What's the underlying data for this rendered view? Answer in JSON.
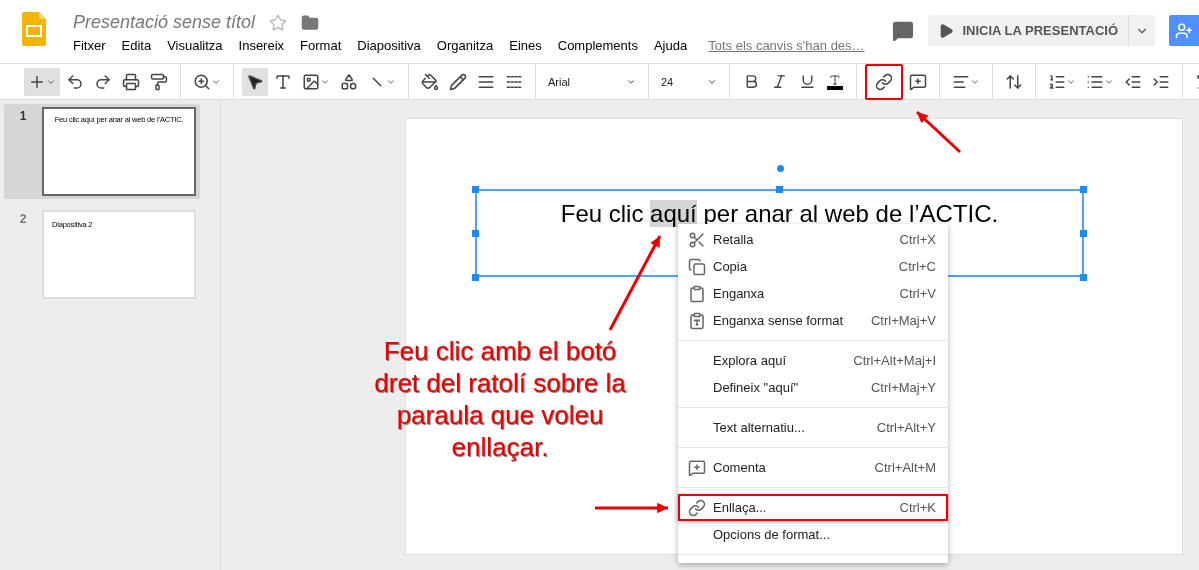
{
  "document": {
    "title": "Presentació sense títol",
    "starred": false
  },
  "menu_bar": [
    "Fitxer",
    "Edita",
    "Visualitza",
    "Insereix",
    "Format",
    "Diapositiva",
    "Organitza",
    "Eines",
    "Complements",
    "Ajuda"
  ],
  "save_status": "Tots els canvis s'han des…",
  "present_button": "INICIA LA PRESENTACIÓ",
  "toolbar": {
    "font": "Arial",
    "font_size": "24",
    "select_tool_selected": true,
    "link_button_outlined": true
  },
  "slides": [
    {
      "number": "1",
      "text": "Feu clic aquí per anar al web de l’ACTIC.",
      "selected": true,
      "kind": "centered"
    },
    {
      "number": "2",
      "text": "Diapositiva 2",
      "selected": false,
      "kind": "left"
    }
  ],
  "slide_text": {
    "before": "Feu clic ",
    "selected": "aquí",
    "after": " per anar al web de l’ACTIC."
  },
  "context_menu": [
    {
      "kind": "cut",
      "label": "Retalla",
      "shortcut": "Ctrl+X",
      "outlined": false
    },
    {
      "kind": "copy",
      "label": "Copia",
      "shortcut": "Ctrl+C",
      "outlined": false
    },
    {
      "kind": "paste",
      "label": "Enganxa",
      "shortcut": "Ctrl+V",
      "outlined": false
    },
    {
      "kind": "pasteplain",
      "label": "Enganxa sense format",
      "shortcut": "Ctrl+Maj+V",
      "outlined": false
    },
    {
      "kind": "separator"
    },
    {
      "kind": "plain",
      "label": "Explora aquí",
      "shortcut": "Ctrl+Alt+Maj+I",
      "outlined": false
    },
    {
      "kind": "plain",
      "label": "Defineix \"aquí\"",
      "shortcut": "Ctrl+Maj+Y",
      "outlined": false
    },
    {
      "kind": "separator"
    },
    {
      "kind": "plain",
      "label": "Text alternatiu...",
      "shortcut": "Ctrl+Alt+Y",
      "outlined": false
    },
    {
      "kind": "separator"
    },
    {
      "kind": "comment",
      "label": "Comenta",
      "shortcut": "Ctrl+Alt+M",
      "outlined": false
    },
    {
      "kind": "separator"
    },
    {
      "kind": "link",
      "label": "Enllaça...",
      "shortcut": "Ctrl+K",
      "outlined": true
    },
    {
      "kind": "plain",
      "label": "Opcions de format...",
      "outlined": false
    },
    {
      "kind": "separator"
    }
  ],
  "callout": "Feu clic amb el botó dret del ratolí sobre la paraula que voleu enllaçar."
}
